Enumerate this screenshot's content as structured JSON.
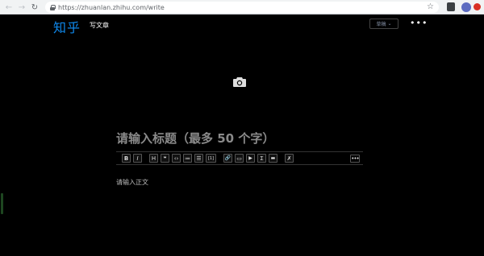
{
  "browser": {
    "url": "https://zhuanlan.zhihu.com/write",
    "back_icon": "arrow-left-icon",
    "forward_icon": "arrow-right-icon",
    "reload_icon": "reload-icon"
  },
  "header": {
    "logo": "知乎",
    "title": "写文章",
    "draft_dropdown": "草稿",
    "more_glyph": "•••"
  },
  "editor": {
    "title_placeholder": "请输入标题（最多 50 个字）",
    "body_placeholder": "请输入正文",
    "toolbar": [
      "B",
      "I",
      "H",
      "❝",
      "‹›",
      "≔",
      "☰",
      "[1]",
      "🔗",
      "▭",
      "▶",
      "Σ",
      "▬",
      "✗"
    ],
    "more_glyph": "•••"
  },
  "colors": {
    "brand": "#0f88eb",
    "background": "#000000"
  }
}
